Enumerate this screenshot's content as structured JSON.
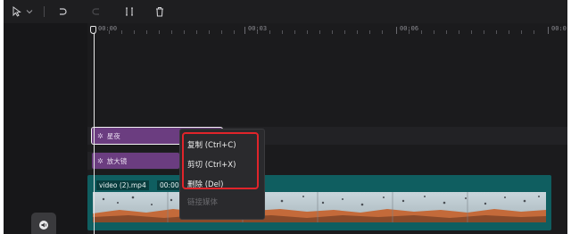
{
  "toolbar": {
    "icons": [
      "select-cursor-icon",
      "chevron-down-icon",
      "undo-icon",
      "redo-icon",
      "split-icon",
      "delete-icon"
    ]
  },
  "ruler": {
    "labels": [
      "00:00",
      "00:03",
      "00:06",
      "00:0"
    ]
  },
  "tracks": {
    "effect1_label": "星夜",
    "effect2_label": "放大镜",
    "video_label": "video (2).mp4",
    "video_time": "00:00"
  },
  "context_menu": {
    "copy": "复制 (Ctrl+C)",
    "cut": "剪切 (Ctrl+X)",
    "delete": "删除 (Del)",
    "link_media": "链接媒体"
  },
  "colors": {
    "background": "#1b1b1d",
    "effect_clip": "#6b3d80",
    "video_clip": "#0f5e60",
    "highlight": "#e0242a"
  }
}
